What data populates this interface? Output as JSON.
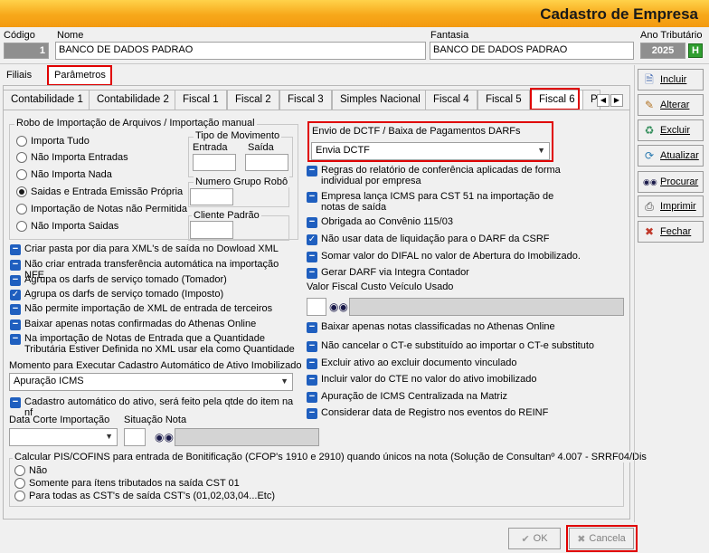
{
  "window": {
    "title": "Cadastro de Empresa"
  },
  "header": {
    "codigo_label": "Código",
    "codigo_value": "1",
    "nome_label": "Nome",
    "nome_value": "BANCO DE DADOS PADRAO",
    "fantasia_label": "Fantasia",
    "fantasia_value": "BANCO DE DADOS PADRAO",
    "ano_label": "Ano Tributário",
    "ano_value": "2025",
    "ano_btn": "H"
  },
  "outer_tabs": [
    "Filiais",
    "Parâmetros"
  ],
  "inner_tabs": [
    "Contabilidade 1",
    "Contabilidade 2",
    "Fiscal 1",
    "Fiscal 2",
    "Fiscal 3",
    "Simples Nacional",
    "Fiscal 4",
    "Fiscal 5",
    "Fiscal 6",
    "P"
  ],
  "robo": {
    "title": "Robo de Importação de Arquivos /  Importação manual",
    "options": [
      "Importa Tudo",
      "Não Importa Entradas",
      "Não Importa Nada",
      "Saidas e Entrada Emissão Própria",
      "Importação de Notas não Permitida",
      "Não Importa Saidas"
    ],
    "selected_index": 3,
    "tipo_mov_label": "Tipo de Movimento",
    "entrada_label": "Entrada",
    "saida_label": "Saída",
    "numero_grupo_label": "Numero Grupo Robô",
    "cliente_padrao_label": "Cliente Padrão"
  },
  "left_checks": [
    "Criar pasta por dia para XML's de saída no Dowload XML",
    "Não criar entrada transferência automática na importação NFE",
    "Agrupa os darfs de serviço tomado (Tomador)",
    "Agrupa os darfs de serviço tomado (Imposto)",
    "Não permite importação de XML de entrada de terceiros",
    "Baixar apenas notas confirmadas do Athenas Online",
    "Na importação de Notas de Entrada que a Quantidade Tributária Estiver Definida no XML usar ela como Quantidade"
  ],
  "momento": {
    "label": "Momento para Executar Cadastro Automático de Ativo Imobilizado",
    "value": "Apuração ICMS"
  },
  "cadastro_auto": "Cadastro automático do ativo, será feito pela qtde do item na nf",
  "data_corte_label": "Data Corte Importação",
  "situacao_label": "Situação Nota",
  "pis": {
    "title": "Calcular PIS/COFINS para entrada de Bonitificação (CFOP's 1910 e 2910) quando únicos na nota (Solução de Consultanº 4.007 - SRRF04/Dis",
    "options": [
      "Não",
      "Somente para ítens tributados na saída CST 01",
      "Para todas as CST's de saída CST's (01,02,03,04...Etc)"
    ]
  },
  "dctf": {
    "label": "Envio de DCTF / Baixa de Pagamentos DARFs",
    "value": "Envia DCTF"
  },
  "right_checks_a": [
    {
      "label": "Regras do relatório de  conferência aplicadas de forma individual por empresa",
      "state": "minus"
    },
    {
      "label": "Empresa lança ICMS para CST 51 na importação de notas de saída",
      "state": "minus"
    },
    {
      "label": "Obrigada ao Convênio 115/03",
      "state": "minus"
    },
    {
      "label": "Não usar data de liquidação para o DARF da CSRF",
      "state": "check"
    },
    {
      "label": "Somar valor do DIFAL no valor de Abertura do Imobilizado.",
      "state": "minus"
    },
    {
      "label": "Gerar DARF via Integra Contador",
      "state": "minus"
    }
  ],
  "valor_fiscal_label": "Valor Fiscal Custo Veículo Usado",
  "right_checks_b": [
    "Baixar apenas notas classificadas no Athenas Online",
    "Não cancelar o CT-e substituído ao importar o CT-e substituto",
    "Excluir ativo ao excluir documento vinculado",
    "Incluir valor do CTE no valor do ativo imobilizado",
    "Apuração de ICMS Centralizada na Matriz",
    "Considerar data de Registro nos eventos do REINF"
  ],
  "side_buttons": [
    {
      "label": "Incluir",
      "icon": "document-icon"
    },
    {
      "label": "Alterar",
      "icon": "edit-icon"
    },
    {
      "label": "Excluir",
      "icon": "recycle-icon"
    },
    {
      "label": "Atualizar",
      "icon": "refresh-icon"
    },
    {
      "label": "Procurar",
      "icon": "binoculars-icon"
    },
    {
      "label": "Imprimir",
      "icon": "printer-icon"
    },
    {
      "label": "Fechar",
      "icon": "close-icon"
    }
  ],
  "footer": {
    "ok": "OK",
    "cancel": "Cancela"
  }
}
